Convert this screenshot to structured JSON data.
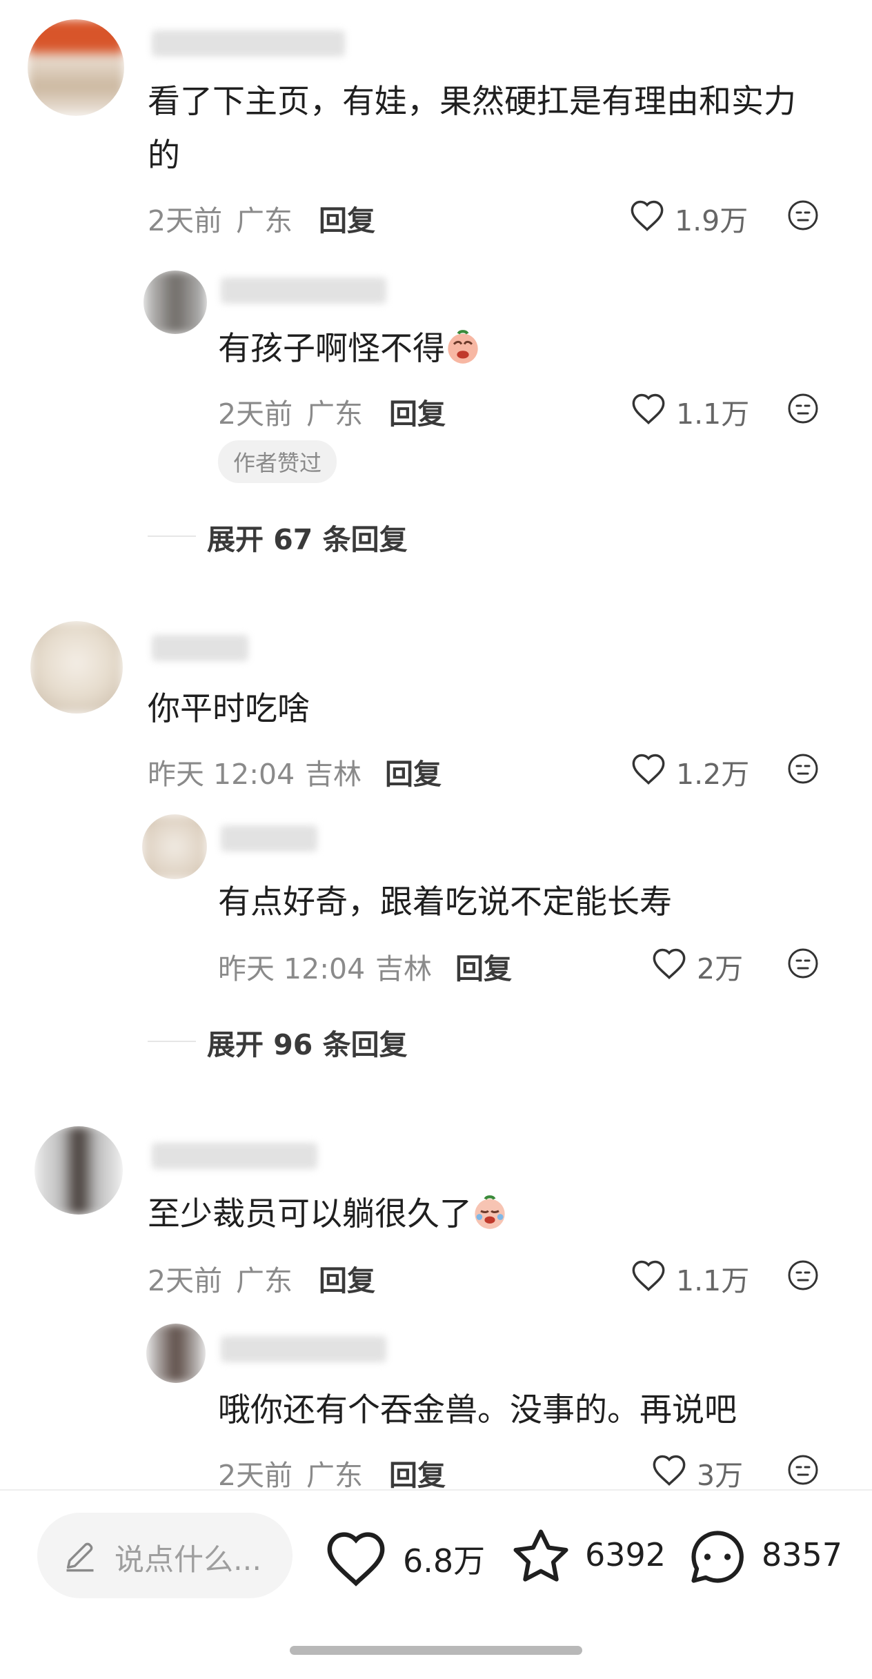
{
  "comments": [
    {
      "text": "看了下主页，有娃，果然硬扛是有理由和实力的",
      "text_line1": "看了下主页，有娃，果然硬扛是有理由和实力",
      "text_line2": "的",
      "time": "2天前",
      "location": "广东",
      "reply_label": "回复",
      "likes": "1.9万",
      "reply": {
        "text": "有孩子啊怪不得",
        "time": "2天前",
        "location": "广东",
        "reply_label": "回复",
        "likes": "1.1万",
        "badge": "作者赞过"
      },
      "expand": "展开 67 条回复"
    },
    {
      "text": "你平时吃啥",
      "time": "昨天 12:04",
      "location": "吉林",
      "reply_label": "回复",
      "likes": "1.2万",
      "reply": {
        "text": "有点好奇，跟着吃说不定能长寿",
        "time": "昨天 12:04",
        "location": "吉林",
        "reply_label": "回复",
        "likes": "2万"
      },
      "expand": "展开 96 条回复"
    },
    {
      "text": "至少裁员可以躺很久了",
      "time": "2天前",
      "location": "广东",
      "reply_label": "回复",
      "likes": "1.1万",
      "reply": {
        "text": "哦你还有个吞金兽。没事的。再说吧",
        "time": "2天前",
        "location": "广东",
        "reply_label": "回复",
        "likes": "3万"
      }
    }
  ],
  "bottom_bar": {
    "input_placeholder": "说点什么...",
    "likes": "6.8万",
    "favorites": "6392",
    "comments": "8357"
  },
  "icons": [
    "heart-icon",
    "neutral-face-icon",
    "pencil-icon",
    "star-icon",
    "chat-bubble-icon",
    "crying-sticker-icon"
  ],
  "colors": {
    "text": "#1f1f1f",
    "meta": "#8a8a8a",
    "badge_bg": "#f1f1f1"
  }
}
